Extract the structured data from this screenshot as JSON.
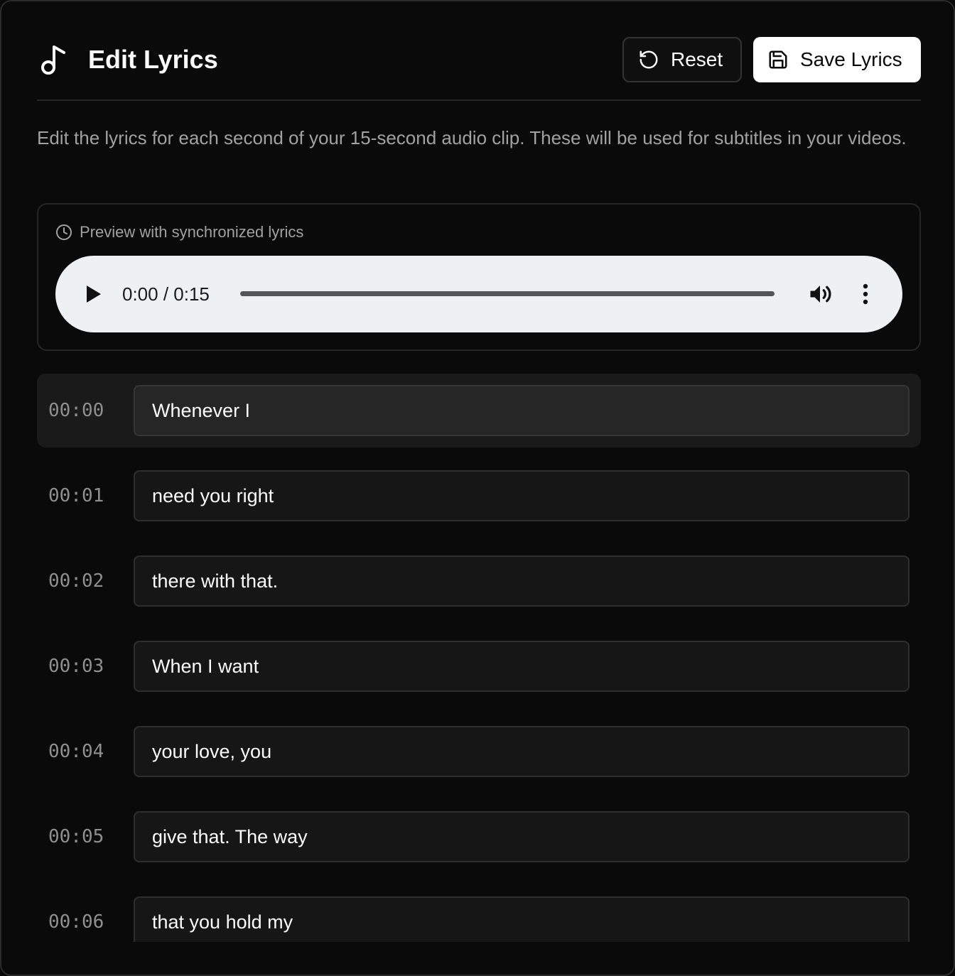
{
  "header": {
    "title": "Edit Lyrics",
    "reset_label": "Reset",
    "save_label": "Save Lyrics"
  },
  "description": "Edit the lyrics for each second of your 15-second audio clip. These will be used for subtitles in your videos.",
  "preview": {
    "label": "Preview with synchronized lyrics",
    "player": {
      "time": "0:00 / 0:15",
      "progress": 0
    }
  },
  "lyrics": [
    {
      "time": "00:00",
      "text": "Whenever I",
      "active": true
    },
    {
      "time": "00:01",
      "text": "need you right",
      "active": false
    },
    {
      "time": "00:02",
      "text": "there with that.",
      "active": false
    },
    {
      "time": "00:03",
      "text": "When I want",
      "active": false
    },
    {
      "time": "00:04",
      "text": "your love, you",
      "active": false
    },
    {
      "time": "00:05",
      "text": "give that. The way",
      "active": false
    },
    {
      "time": "00:06",
      "text": "that you hold my",
      "active": false
    }
  ],
  "icons": {
    "title": "music-note-icon",
    "reset": "rotate-ccw-icon",
    "save": "save-icon",
    "preview": "clock-icon",
    "play": "play-icon",
    "volume": "volume-icon",
    "more": "more-vertical-icon"
  },
  "colors": {
    "background": "#0a0a0a",
    "text": "#fafafa",
    "muted": "#a1a1a1",
    "border": "#262626",
    "active_row": "#1a1a1a",
    "save_button": "#ffffff",
    "player_bg": "#eef1f3"
  }
}
